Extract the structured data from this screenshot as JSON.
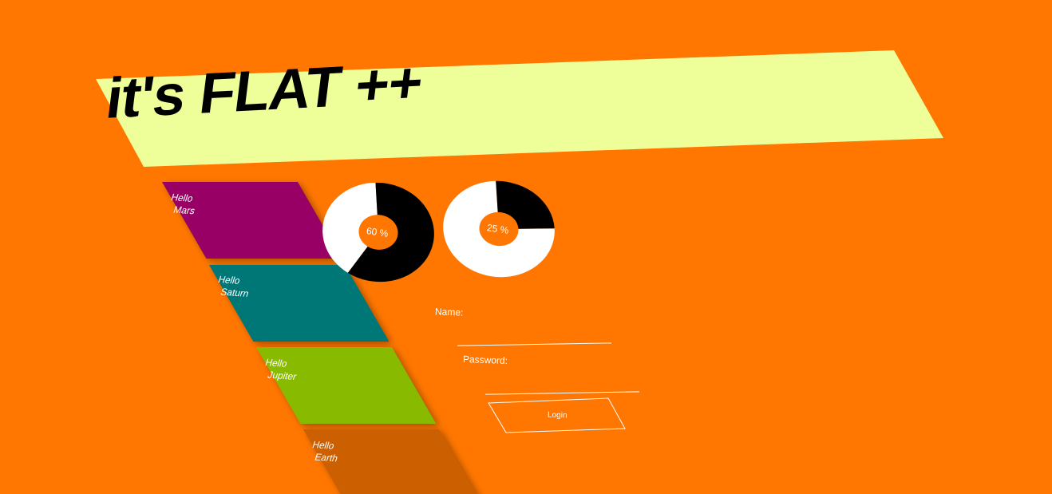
{
  "header": {
    "title": "it's FLAT ++",
    "background_color": "#eeff99"
  },
  "tiles": [
    {
      "line1": "Hello",
      "line2": "Mars",
      "color": "#990066"
    },
    {
      "line1": "Hello",
      "line2": "Saturn",
      "color": "#007777"
    },
    {
      "line1": "Hello",
      "line2": "Jupiter",
      "color": "#88bb00"
    },
    {
      "line1": "Hello",
      "line2": "Earth",
      "color": "#cc5f00"
    }
  ],
  "gauges": [
    {
      "label": "60 %",
      "value": 60
    },
    {
      "label": "25 %",
      "value": 25
    }
  ],
  "form": {
    "name_label": "Name:",
    "name_value": "",
    "password_label": "Password:",
    "password_value": "",
    "login_label": "Login"
  },
  "colors": {
    "page_background": "#ff7700",
    "gauge_fill": "#000000",
    "gauge_empty": "#ffffff",
    "text_light": "#ffffff"
  }
}
